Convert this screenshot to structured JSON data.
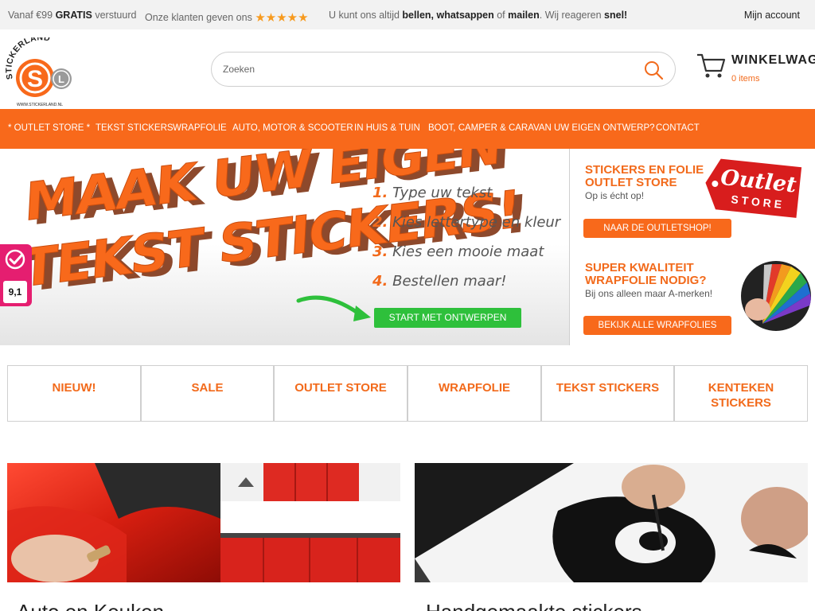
{
  "topbar": {
    "ship_pre": "Vanaf €99",
    "ship_bold": "GRATIS",
    "ship_post": "verstuurd",
    "review_text": "Onze klanten geven ons",
    "review_stars": "★★★★★",
    "contact_pre": "U kunt ons altijd",
    "contact_bold": "bellen, whatsappen",
    "contact_mid": "of",
    "contact_link": "mailen",
    "contact_post": ". Wij reageren",
    "contact_end": "snel!",
    "account": "Mijn account"
  },
  "header": {
    "logo_text": "STICKERLAND",
    "logo_url_text": "WWW.STICKERLAND.NL",
    "search_placeholder": "Zoeken",
    "cart_title": "WINKELWAG",
    "cart_count": "0 items"
  },
  "nav": {
    "items": [
      "* OUTLET STORE *",
      "TEKST STICKERS",
      "WRAPFOLIE",
      "AUTO, MOTOR & SCOOTER",
      "IN HUIS & TUIN",
      "BOOT, CAMPER & CARAVAN",
      "UW EIGEN ONTWERP?",
      "CONTACT"
    ]
  },
  "hero": {
    "headline_1": "MAAK UW EIGEN",
    "headline_2": "TEKST STICKERS!",
    "steps": [
      {
        "num": "1.",
        "text": "Type uw tekst"
      },
      {
        "num": "2.",
        "text": "Kies lettertype en kleur"
      },
      {
        "num": "3.",
        "text": "Kies een mooie maat"
      },
      {
        "num": "4.",
        "text": "Bestellen maar!"
      }
    ],
    "cta": "START MET ONTWERPEN"
  },
  "promos": {
    "outlet_title_1": "STICKERS EN FOLIE",
    "outlet_title_2": "OUTLET STORE",
    "outlet_sub": "Op is écht op!",
    "outlet_btn": "NAAR DE OUTLETSHOP!",
    "outlet_logo_1": "Outlet",
    "outlet_logo_2": "STORE",
    "wrap_title_1": "SUPER KWALITEIT",
    "wrap_title_2": "WRAPFOLIE NODIG?",
    "wrap_sub": "Bij ons alleen maar A-merken!",
    "wrap_btn": "BEKIJK ALLE WRAPFOLIES"
  },
  "badge": {
    "score": "9,1"
  },
  "categories": [
    {
      "line1": "NIEUW!",
      "line2": ""
    },
    {
      "line1": "SALE",
      "line2": ""
    },
    {
      "line1": "OUTLET STORE",
      "line2": ""
    },
    {
      "line1": "WRAPFOLIE",
      "line2": ""
    },
    {
      "line1": "TEKST STICKERS",
      "line2": ""
    },
    {
      "line1": "KENTEKEN",
      "line2": "STICKERS"
    }
  ],
  "bottom": {
    "left_heading": "Auto en Keuken",
    "right_heading": "Handgemaakte stickers"
  },
  "colors": {
    "brand_orange": "#f8691b",
    "accent_green": "#2ec03b",
    "badge_pink": "#e51e70"
  }
}
